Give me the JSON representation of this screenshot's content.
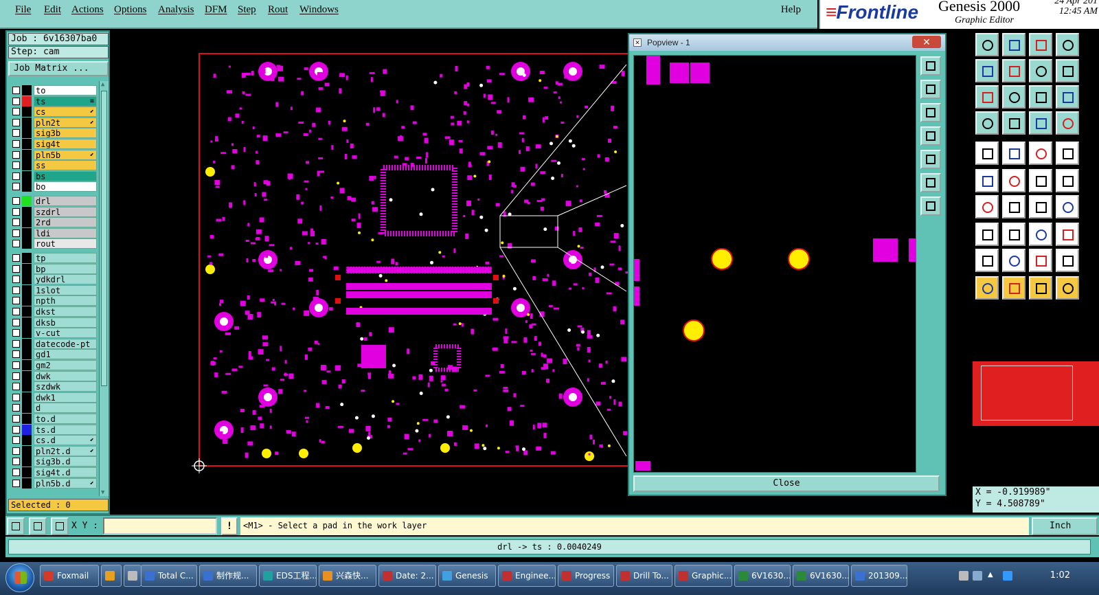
{
  "menu": {
    "items": [
      "File",
      "Edit",
      "Actions",
      "Options",
      "Analysis",
      "DFM",
      "Step",
      "Rout",
      "Windows"
    ],
    "help": "Help"
  },
  "brand": {
    "logo": "Frontline",
    "app": "Genesis 2000",
    "subtitle": "Graphic Editor",
    "date": "24 Apr 201",
    "time": "12:45 AM"
  },
  "job": {
    "job_label": "Job : 6v16307ba0",
    "step_label": "Step: cam",
    "matrix_button": "Job Matrix ..."
  },
  "layers": [
    {
      "name": "to",
      "color": "#ffffff",
      "swatch": "#000000",
      "mark": ""
    },
    {
      "name": "ts",
      "color": "#1fa58a",
      "swatch": "#e02020",
      "mark": "≡"
    },
    {
      "name": "cs",
      "color": "#f5c842",
      "swatch": "#000000",
      "mark": "⬋"
    },
    {
      "name": "pln2t",
      "color": "#f5c842",
      "swatch": "#000000",
      "mark": "⬋"
    },
    {
      "name": "sig3b",
      "color": "#f5c842",
      "swatch": "#000000",
      "mark": ""
    },
    {
      "name": "sig4t",
      "color": "#f5c842",
      "swatch": "#000000",
      "mark": ""
    },
    {
      "name": "pln5b",
      "color": "#f5c842",
      "swatch": "#000000",
      "mark": "⬋"
    },
    {
      "name": "ss",
      "color": "#f5c842",
      "swatch": "#000000",
      "mark": ""
    },
    {
      "name": "bs",
      "color": "#1fa58a",
      "swatch": "#000000",
      "mark": ""
    },
    {
      "name": "bo",
      "color": "#ffffff",
      "swatch": "#000000",
      "mark": ""
    },
    {
      "name": "drl",
      "color": "#c8c8c8",
      "swatch": "#20e020",
      "mark": ""
    },
    {
      "name": "szdrl",
      "color": "#c8c8c8",
      "swatch": "#000000",
      "mark": ""
    },
    {
      "name": "2rd",
      "color": "#c8c8c8",
      "swatch": "#000000",
      "mark": ""
    },
    {
      "name": "ldi",
      "color": "#c8c8c8",
      "swatch": "#000000",
      "mark": ""
    },
    {
      "name": "rout",
      "color": "#e8e8e8",
      "swatch": "#000000",
      "mark": ""
    },
    {
      "name": "tp",
      "color": "#9fdcd3",
      "swatch": "#000000",
      "mark": ""
    },
    {
      "name": "bp",
      "color": "#9fdcd3",
      "swatch": "#000000",
      "mark": ""
    },
    {
      "name": "ydkdrl",
      "color": "#9fdcd3",
      "swatch": "#000000",
      "mark": ""
    },
    {
      "name": "1slot",
      "color": "#9fdcd3",
      "swatch": "#000000",
      "mark": ""
    },
    {
      "name": "npth",
      "color": "#9fdcd3",
      "swatch": "#000000",
      "mark": ""
    },
    {
      "name": "dkst",
      "color": "#9fdcd3",
      "swatch": "#000000",
      "mark": ""
    },
    {
      "name": "dksb",
      "color": "#9fdcd3",
      "swatch": "#000000",
      "mark": ""
    },
    {
      "name": "v-cut",
      "color": "#9fdcd3",
      "swatch": "#000000",
      "mark": ""
    },
    {
      "name": "datecode-pt",
      "color": "#9fdcd3",
      "swatch": "#000000",
      "mark": ""
    },
    {
      "name": "gd1",
      "color": "#9fdcd3",
      "swatch": "#000000",
      "mark": ""
    },
    {
      "name": "gm2",
      "color": "#9fdcd3",
      "swatch": "#000000",
      "mark": ""
    },
    {
      "name": "dwk",
      "color": "#9fdcd3",
      "swatch": "#000000",
      "mark": ""
    },
    {
      "name": "szdwk",
      "color": "#9fdcd3",
      "swatch": "#000000",
      "mark": ""
    },
    {
      "name": "dwk1",
      "color": "#9fdcd3",
      "swatch": "#000000",
      "mark": ""
    },
    {
      "name": "d",
      "color": "#9fdcd3",
      "swatch": "#000000",
      "mark": ""
    },
    {
      "name": "to.d",
      "color": "#9fdcd3",
      "swatch": "#000000",
      "mark": ""
    },
    {
      "name": "ts.d",
      "color": "#9fdcd3",
      "swatch": "#2020e0",
      "mark": ""
    },
    {
      "name": "cs.d",
      "color": "#9fdcd3",
      "swatch": "#000000",
      "mark": "⬋"
    },
    {
      "name": "pln2t.d",
      "color": "#9fdcd3",
      "swatch": "#000000",
      "mark": "⬋"
    },
    {
      "name": "sig3b.d",
      "color": "#9fdcd3",
      "swatch": "#000000",
      "mark": ""
    },
    {
      "name": "sig4t.d",
      "color": "#9fdcd3",
      "swatch": "#000000",
      "mark": ""
    },
    {
      "name": "pln5b.d",
      "color": "#9fdcd3",
      "swatch": "#000000",
      "mark": "⬋"
    }
  ],
  "selected_label": "Selected : 0",
  "popview": {
    "title": "Popview - 1",
    "close_x": "✕",
    "close_button": "Close"
  },
  "coords": {
    "x": "X = -0.919989\"",
    "y": "Y = 4.508789\""
  },
  "command": {
    "xy_label": "X Y :",
    "xy_value": "",
    "warn": "!",
    "prompt": "<M1> - Select a pad in the work layer",
    "units": "Inch"
  },
  "status": "drl -> ts : 0.0040249",
  "taskbar": {
    "tasks": [
      {
        "label": "Foxmail",
        "color": "#d43a2a"
      },
      {
        "label": "",
        "color": "#e8a020"
      },
      {
        "label": "",
        "color": "#bbbbbb"
      },
      {
        "label": "Total C...",
        "color": "#3a70d0"
      },
      {
        "label": "制作规...",
        "color": "#3a70d0"
      },
      {
        "label": "EDS工程...",
        "color": "#20a0a0"
      },
      {
        "label": "兴森快...",
        "color": "#e89020"
      },
      {
        "label": "Date: 2...",
        "color": "#c03030"
      },
      {
        "label": "Genesis",
        "color": "#40a0e0"
      },
      {
        "label": "Enginee...",
        "color": "#c03030"
      },
      {
        "label": "Progress",
        "color": "#c03030"
      },
      {
        "label": "Drill To...",
        "color": "#c03030"
      },
      {
        "label": "Graphic...",
        "color": "#c03030"
      },
      {
        "label": "6V1630...",
        "color": "#2a8a3a"
      },
      {
        "label": "6V1630...",
        "color": "#2a8a3a"
      },
      {
        "label": "201309...",
        "color": "#3a70d0"
      }
    ],
    "clock": "1:02"
  }
}
